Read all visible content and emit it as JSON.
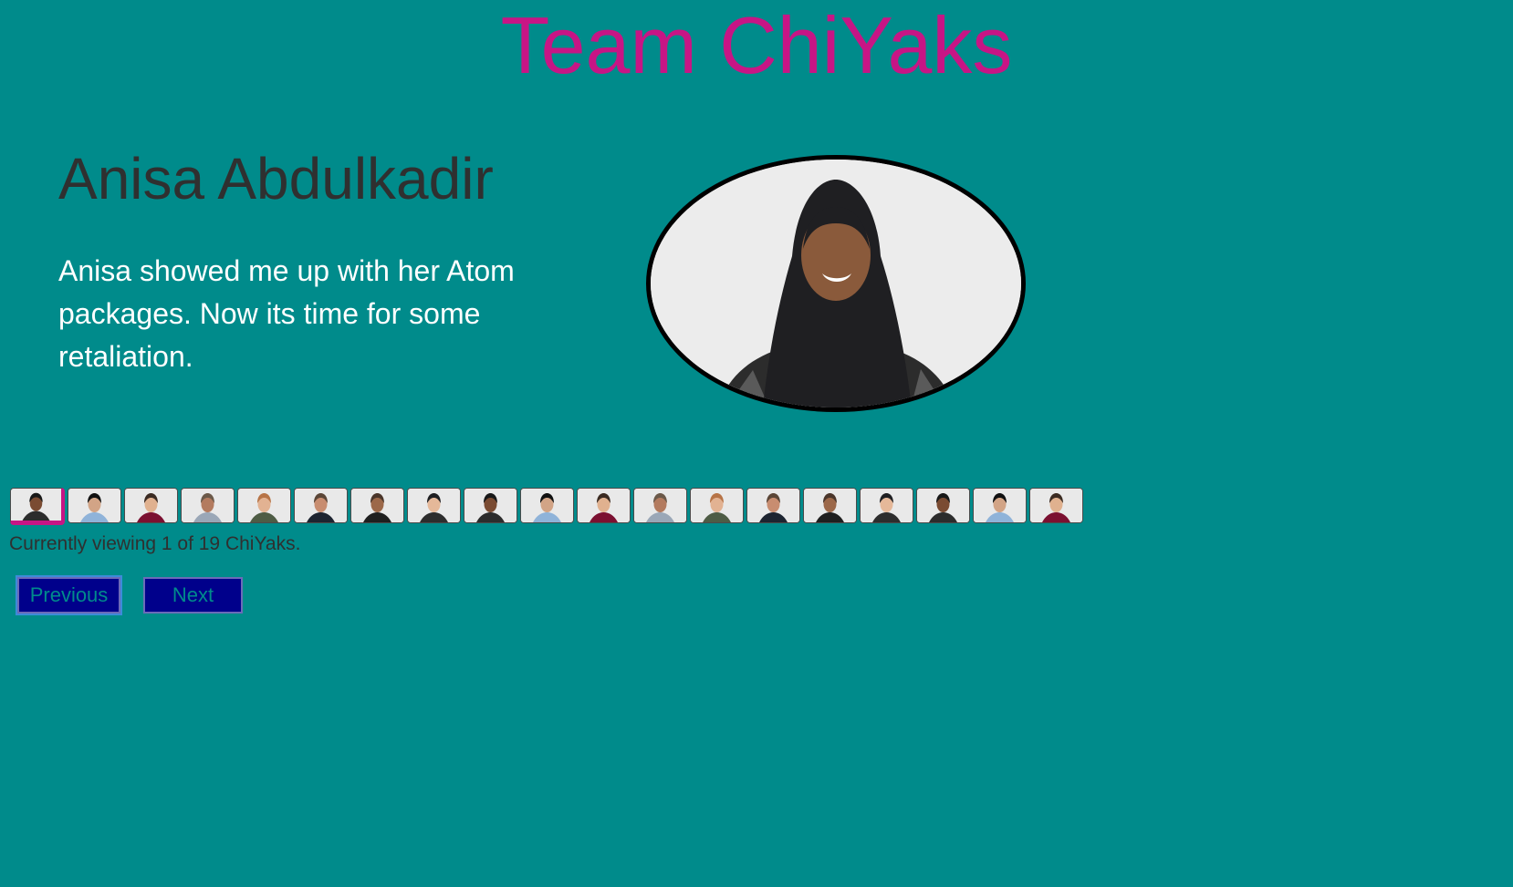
{
  "page": {
    "title": "Team ChiYaks"
  },
  "profile": {
    "name": "Anisa Abdulkadir",
    "bio": "Anisa showed me up with her Atom packages. Now its time for some retaliation.",
    "portrait_icon": "person-portrait"
  },
  "thumbnails": {
    "count": 19,
    "active_index": 1,
    "icon": "person-thumbnail"
  },
  "status": {
    "text": "Currently viewing 1 of 19 ChiYaks."
  },
  "controls": {
    "previous_label": "Previous",
    "next_label": "Next"
  },
  "colors": {
    "background": "#008b8b",
    "title": "#c71585",
    "name": "#2f3030",
    "bio": "#ffffff",
    "button_bg": "#00008b",
    "button_text": "#008b8b",
    "active_thumb_marker": "#c71585"
  }
}
